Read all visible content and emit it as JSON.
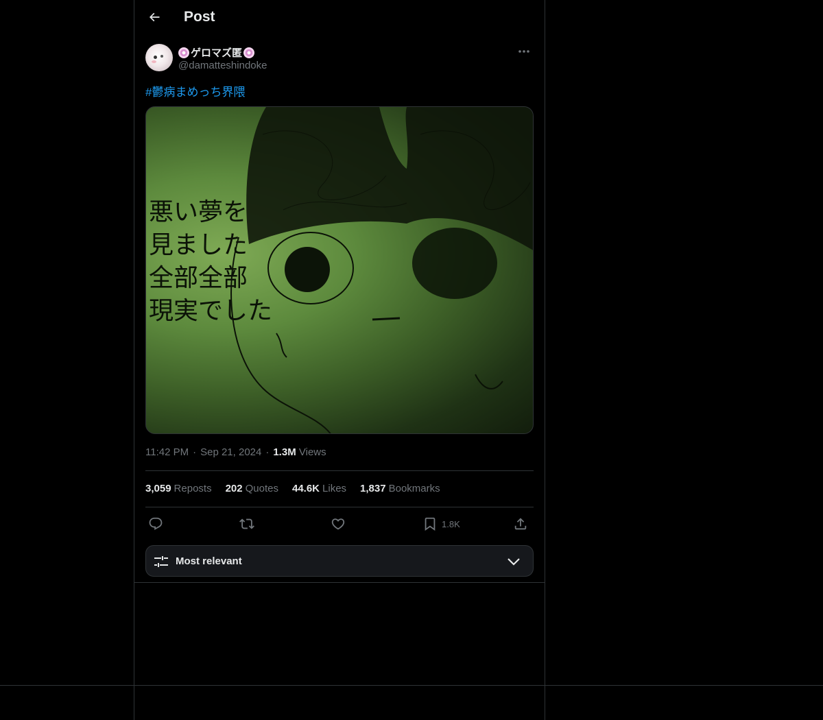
{
  "header": {
    "title": "Post",
    "back_icon": "arrow-left-icon"
  },
  "post": {
    "author": {
      "display_name": "ゲロマズ匿",
      "handle": "@damatteshindoke",
      "name_decoration_icon": "flower-emoji-icon"
    },
    "text": "#鬱病まめっち界隈",
    "media": {
      "alt_description_visible": false,
      "handwritten_lines": [
        "悪い夢を",
        "見ました",
        "全部全部",
        "現実でした"
      ]
    },
    "time": "11:42 PM",
    "date": "Sep 21, 2024",
    "views_count": "1.3M",
    "views_label": "Views"
  },
  "stats": {
    "reposts": {
      "count": "3,059",
      "label": "Reposts"
    },
    "quotes": {
      "count": "202",
      "label": "Quotes"
    },
    "likes": {
      "count": "44.6K",
      "label": "Likes"
    },
    "bookmarks": {
      "count": "1,837",
      "label": "Bookmarks"
    }
  },
  "actions": {
    "bookmark_count": "1.8K"
  },
  "replies": {
    "sort_label": "Most relevant"
  },
  "colors": {
    "background": "#000000",
    "text": "#e7e9ea",
    "muted": "#71767b",
    "link": "#1d9bf0",
    "border": "#2f3336"
  }
}
